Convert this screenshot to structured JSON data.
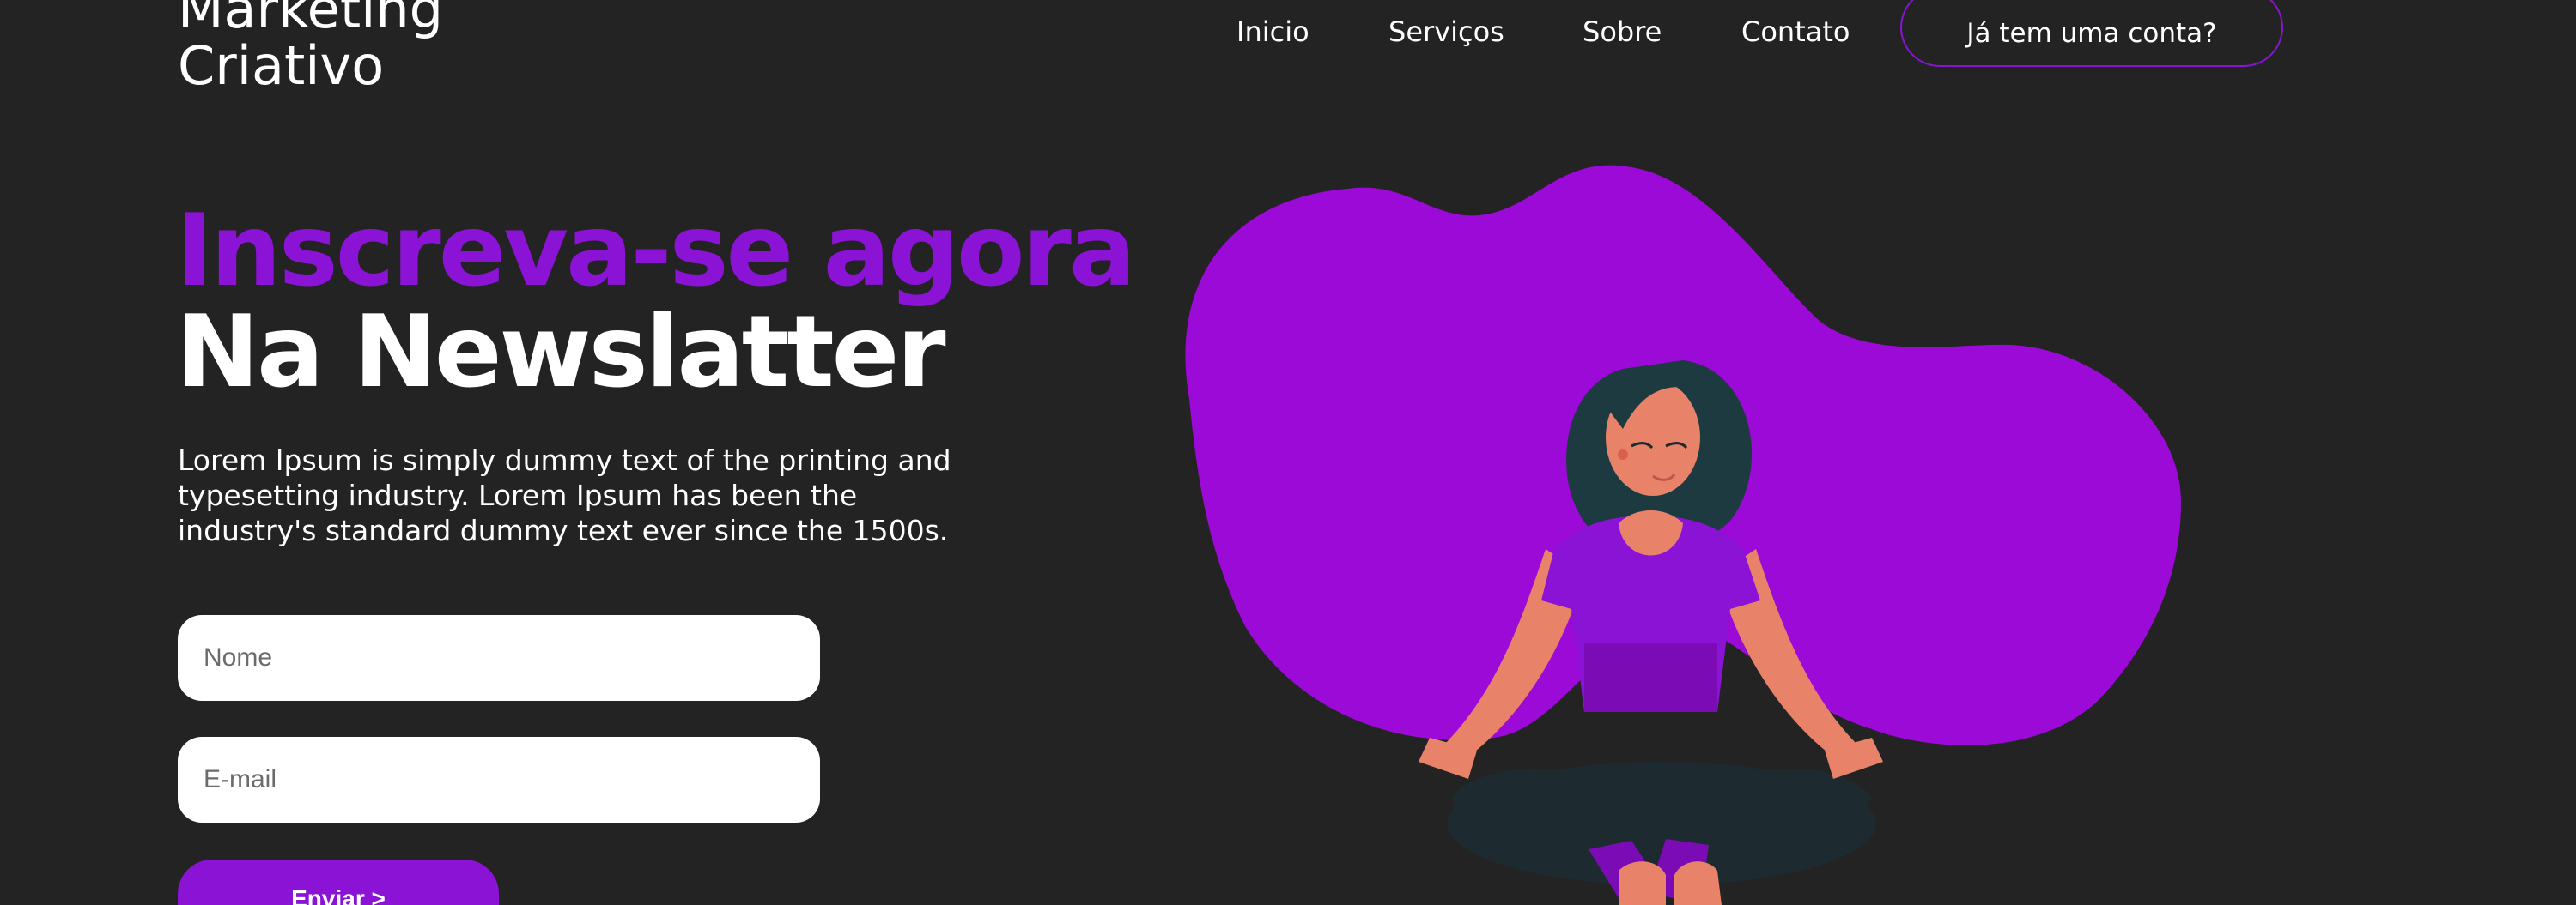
{
  "brand": {
    "line1": "Marketing",
    "line2": "Criativo"
  },
  "nav": {
    "items": [
      "Inicio",
      "Serviços",
      "Sobre",
      "Contato"
    ],
    "login_label": "Já tem uma conta?"
  },
  "hero": {
    "headline_accent": "Inscreva-se agora",
    "headline_main": "Na Newslatter",
    "description": "Lorem Ipsum is simply dummy text of the printing and typesetting industry. Lorem Ipsum has been the industry's standard dummy text ever since the 1500s."
  },
  "form": {
    "name_placeholder": "Nome",
    "email_placeholder": "E-mail",
    "submit_label": "Enviar >"
  },
  "colors": {
    "background": "#232323",
    "accent": "#8a13d6",
    "blob": "#9b0ad6",
    "text": "#ffffff"
  },
  "illustration": {
    "icon": "meditating-woman-illustration"
  }
}
